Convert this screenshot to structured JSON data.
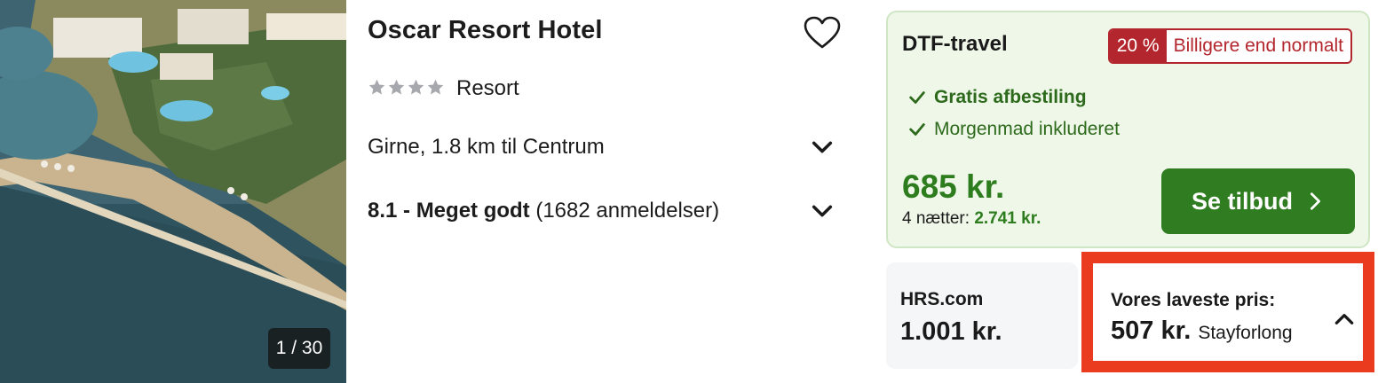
{
  "hotel": {
    "name": "Oscar Resort Hotel",
    "star_rating": 4,
    "type": "Resort",
    "location": "Girne, 1.8 km til Centrum",
    "rating_label": "8.1 - Meget godt",
    "review_count": "(1682 anmeldelser)"
  },
  "gallery": {
    "counter": "1 / 30"
  },
  "featured_deal": {
    "provider": "DTF-travel",
    "discount_percent": "20 %",
    "discount_text": "Billigere end normalt",
    "features": [
      "Gratis afbestiling",
      "Morgenmad inkluderet"
    ],
    "price": "685 kr.",
    "nights_label": "4 nætter:",
    "nights_total": "2.741 kr.",
    "cta_label": "Se tilbud"
  },
  "alternative_deal": {
    "provider": "HRS.com",
    "price": "1.001 kr."
  },
  "lowest_price": {
    "label": "Vores laveste pris:",
    "price": "507 kr.",
    "provider": "Stayforlong"
  },
  "icons": {
    "favorite": "heart-outline-icon",
    "expand": "chevron-down-icon",
    "collapse": "chevron-up-icon",
    "check": "check-icon",
    "cta": "chevron-right-icon"
  },
  "colors": {
    "green": "#2f7d20",
    "deal_background": "#eef7e8",
    "discount_red": "#b3262d",
    "highlight_border": "#ea3b1f"
  }
}
